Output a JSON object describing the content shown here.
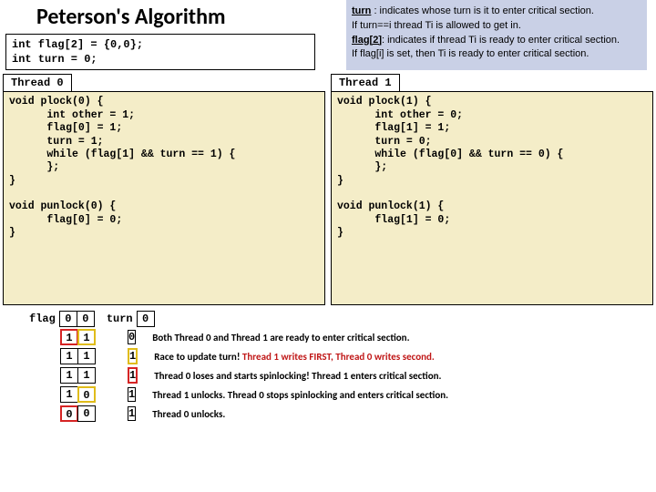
{
  "title": "Peterson's Algorithm",
  "decl": {
    "line1": "int flag[2] = {0,0};",
    "line2": "int turn = 0;"
  },
  "notes": {
    "n1a": "turn",
    "n1b": " : indicates whose turn is it to enter critical section.",
    "n2": "If turn==i thread Ti is allowed to get in.",
    "n3a": "flag[2]",
    "n3b": ": indicates if thread Ti is ready to enter critical section.",
    "n4": "If flag[i] is set, then Ti is ready to enter critical section."
  },
  "thread0": {
    "tab": "Thread 0",
    "code": "void plock(0) {\n      int other = 1;\n      flag[0] = 1;\n      turn = 1;\n      while (flag[1] && turn == 1) {\n      };\n}\n\nvoid punlock(0) {\n      flag[0] = 0;\n}"
  },
  "thread1": {
    "tab": "Thread 1",
    "code": "void plock(1) {\n      int other = 0;\n      flag[1] = 1;\n      turn = 0;\n      while (flag[0] && turn == 0) {\n      };\n}\n\nvoid punlock(1) {\n      flag[1] = 0;\n}"
  },
  "trace": {
    "flag_label": "flag",
    "turn_label": "turn",
    "header_flag": [
      "0",
      "0"
    ],
    "header_turn": "0",
    "rows": [
      {
        "flag": [
          "1",
          "1"
        ],
        "turn": "0",
        "hl_flag": [
          "red",
          "yel"
        ],
        "hl_turn": "",
        "desc_plain": "Both Thread 0 and Thread 1 are ready to enter critical section.",
        "desc_red": ""
      },
      {
        "flag": [
          "1",
          "1"
        ],
        "turn": "1",
        "hl_flag": [
          "",
          ""
        ],
        "hl_turn": "yel",
        "desc_plain": "Race to update turn! ",
        "desc_red": "Thread 1 writes FIRST, Thread 0 writes second."
      },
      {
        "flag": [
          "1",
          "1"
        ],
        "turn": "1",
        "hl_flag": [
          "",
          ""
        ],
        "hl_turn": "red",
        "desc_plain": "Thread 0 loses and starts spinlocking! Thread 1 enters critical section.",
        "desc_red": ""
      },
      {
        "flag": [
          "1",
          "0"
        ],
        "turn": "1",
        "hl_flag": [
          "",
          "yel"
        ],
        "hl_turn": "",
        "desc_plain": "Thread 1 unlocks. Thread 0 stops spinlocking and enters critical section.",
        "desc_red": ""
      },
      {
        "flag": [
          "0",
          "0"
        ],
        "turn": "1",
        "hl_flag": [
          "red",
          ""
        ],
        "hl_turn": "",
        "desc_plain": "Thread 0 unlocks.",
        "desc_red": ""
      }
    ]
  }
}
